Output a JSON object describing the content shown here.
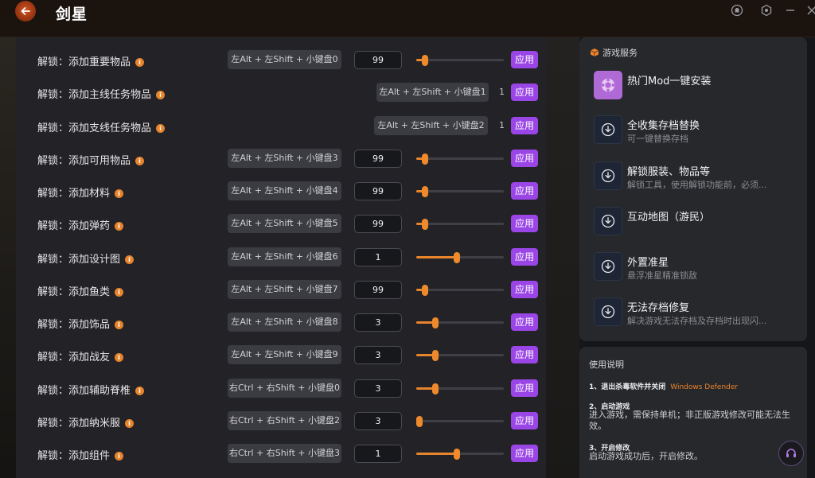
{
  "app": {
    "title": "剑星"
  },
  "rows": [
    {
      "label": "解锁：添加重要物品",
      "hotkey": "左Alt + 左Shift + 小键盘0",
      "value": "99",
      "slider": 0.1,
      "apply": "应用",
      "type": "full"
    },
    {
      "label": "解锁：添加主线任务物品",
      "hotkey": "左Alt + 左Shift + 小键盘1",
      "value": "1",
      "apply": "应用",
      "type": "compact"
    },
    {
      "label": "解锁：添加支线任务物品",
      "hotkey": "左Alt + 左Shift + 小键盘2",
      "value": "1",
      "apply": "应用",
      "type": "compact"
    },
    {
      "label": "解锁：添加可用物品",
      "hotkey": "左Alt + 左Shift + 小键盘3",
      "value": "99",
      "slider": 0.1,
      "apply": "应用",
      "type": "full"
    },
    {
      "label": "解锁：添加材料",
      "hotkey": "左Alt + 左Shift + 小键盘4",
      "value": "99",
      "slider": 0.1,
      "apply": "应用",
      "type": "full"
    },
    {
      "label": "解锁：添加弹药",
      "hotkey": "左Alt + 左Shift + 小键盘5",
      "value": "99",
      "slider": 0.1,
      "apply": "应用",
      "type": "full"
    },
    {
      "label": "解锁：添加设计图",
      "hotkey": "左Alt + 左Shift + 小键盘6",
      "value": "1",
      "slider": 0.46,
      "apply": "应用",
      "type": "full"
    },
    {
      "label": "解锁：添加鱼类",
      "hotkey": "左Alt + 左Shift + 小键盘7",
      "value": "99",
      "slider": 0.1,
      "apply": "应用",
      "type": "full"
    },
    {
      "label": "解锁：添加饰品",
      "hotkey": "左Alt + 左Shift + 小键盘8",
      "value": "3",
      "slider": 0.22,
      "apply": "应用",
      "type": "full"
    },
    {
      "label": "解锁：添加战友",
      "hotkey": "左Alt + 左Shift + 小键盘9",
      "value": "3",
      "slider": 0.22,
      "apply": "应用",
      "type": "full"
    },
    {
      "label": "解锁：添加辅助脊椎",
      "hotkey": "右Ctrl + 右Shift + 小键盘0",
      "value": "3",
      "slider": 0.22,
      "apply": "应用",
      "type": "full"
    },
    {
      "label": "解锁：添加纳米服",
      "hotkey": "右Ctrl + 右Shift + 小键盘2",
      "value": "3",
      "slider": 0.0,
      "apply": "应用",
      "type": "full"
    },
    {
      "label": "解锁：添加组件",
      "hotkey": "右Ctrl + 右Shift + 小键盘3",
      "value": "1",
      "slider": 0.46,
      "apply": "应用",
      "type": "full"
    }
  ],
  "services": {
    "header": "游戏服务",
    "items": [
      {
        "title": "热门Mod一键安装",
        "subtitle": "",
        "icon": "mod-icon"
      },
      {
        "title": "全收集存档替换",
        "subtitle": "可一键替换存档",
        "icon": "download-icon"
      },
      {
        "title": "解锁服装、物品等",
        "subtitle": "解锁工具，使用解锁功能前，必须...",
        "icon": "download-icon"
      },
      {
        "title": "互动地图（游民）",
        "subtitle": "",
        "icon": "download-icon"
      },
      {
        "title": "外置准星",
        "subtitle": "悬浮准星精准锁敌",
        "icon": "download-icon"
      },
      {
        "title": "无法存档修复",
        "subtitle": "解决游戏无法存档及存档时出现闪...",
        "icon": "download-icon"
      }
    ]
  },
  "instructions": {
    "title": "使用说明",
    "step1_title": "1、退出杀毒软件并关闭",
    "step1_highlight": "Windows Defender",
    "step2_title": "2、启动游戏",
    "step2_text": "进入游戏，需保持单机；非正版游戏修改可能无法生效。",
    "step3_title": "3、开启修改",
    "step3_text": "启动游戏成功后，开启修改。"
  },
  "colors": {
    "accent": "#9a45e6",
    "slider": "#e8842c",
    "back_button": "#c8501e"
  }
}
